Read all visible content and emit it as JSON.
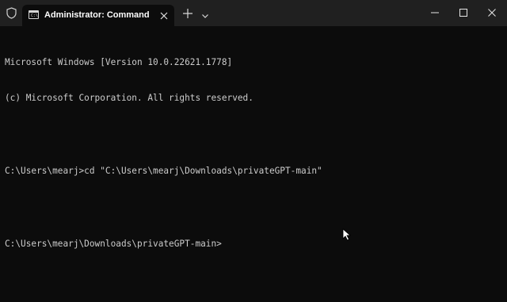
{
  "window": {
    "tab_title": "Administrator: Command Pro",
    "shield_icon": "shield-icon",
    "tab_icon": "terminal-icon",
    "close_tab_icon": "close-icon",
    "new_tab_icon": "plus-icon",
    "dropdown_icon": "chevron-down-icon",
    "minimize_icon": "minimize-icon",
    "maximize_icon": "maximize-icon",
    "close_window_icon": "close-icon"
  },
  "terminal": {
    "lines": [
      "Microsoft Windows [Version 10.0.22621.1778]",
      "(c) Microsoft Corporation. All rights reserved.",
      "",
      "C:\\Users\\mearj>cd \"C:\\Users\\mearj\\Downloads\\privateGPT-main\"",
      "",
      "C:\\Users\\mearj\\Downloads\\privateGPT-main>"
    ]
  },
  "colors": {
    "titlebar": "#202020",
    "background": "#0c0c0c",
    "text": "#cccccc",
    "tab_text": "#ffffff"
  }
}
